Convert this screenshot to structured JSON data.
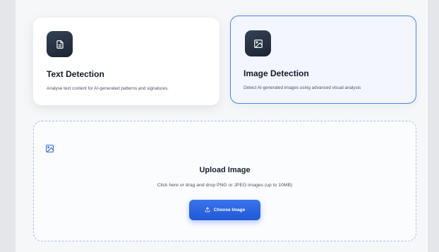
{
  "cards": [
    {
      "title": "Text Detection",
      "description": "Analyse text content for AI-generated patterns and signatures.",
      "icon": "document-icon",
      "selected": false
    },
    {
      "title": "Image Detection",
      "description": "Detect AI-generated images using advanced visual analysis",
      "icon": "image-icon",
      "selected": true
    }
  ],
  "upload": {
    "icon": "image-icon",
    "title": "Upload Image",
    "subtitle": "Click here or drag and drop PNG or JPEG images (up to 10MB)",
    "button_label": "Choose Image",
    "button_icon": "upload-icon"
  },
  "colors": {
    "accent": "#2f67e3",
    "selected_border": "#4d84e6",
    "icon_tile": "#263144"
  }
}
